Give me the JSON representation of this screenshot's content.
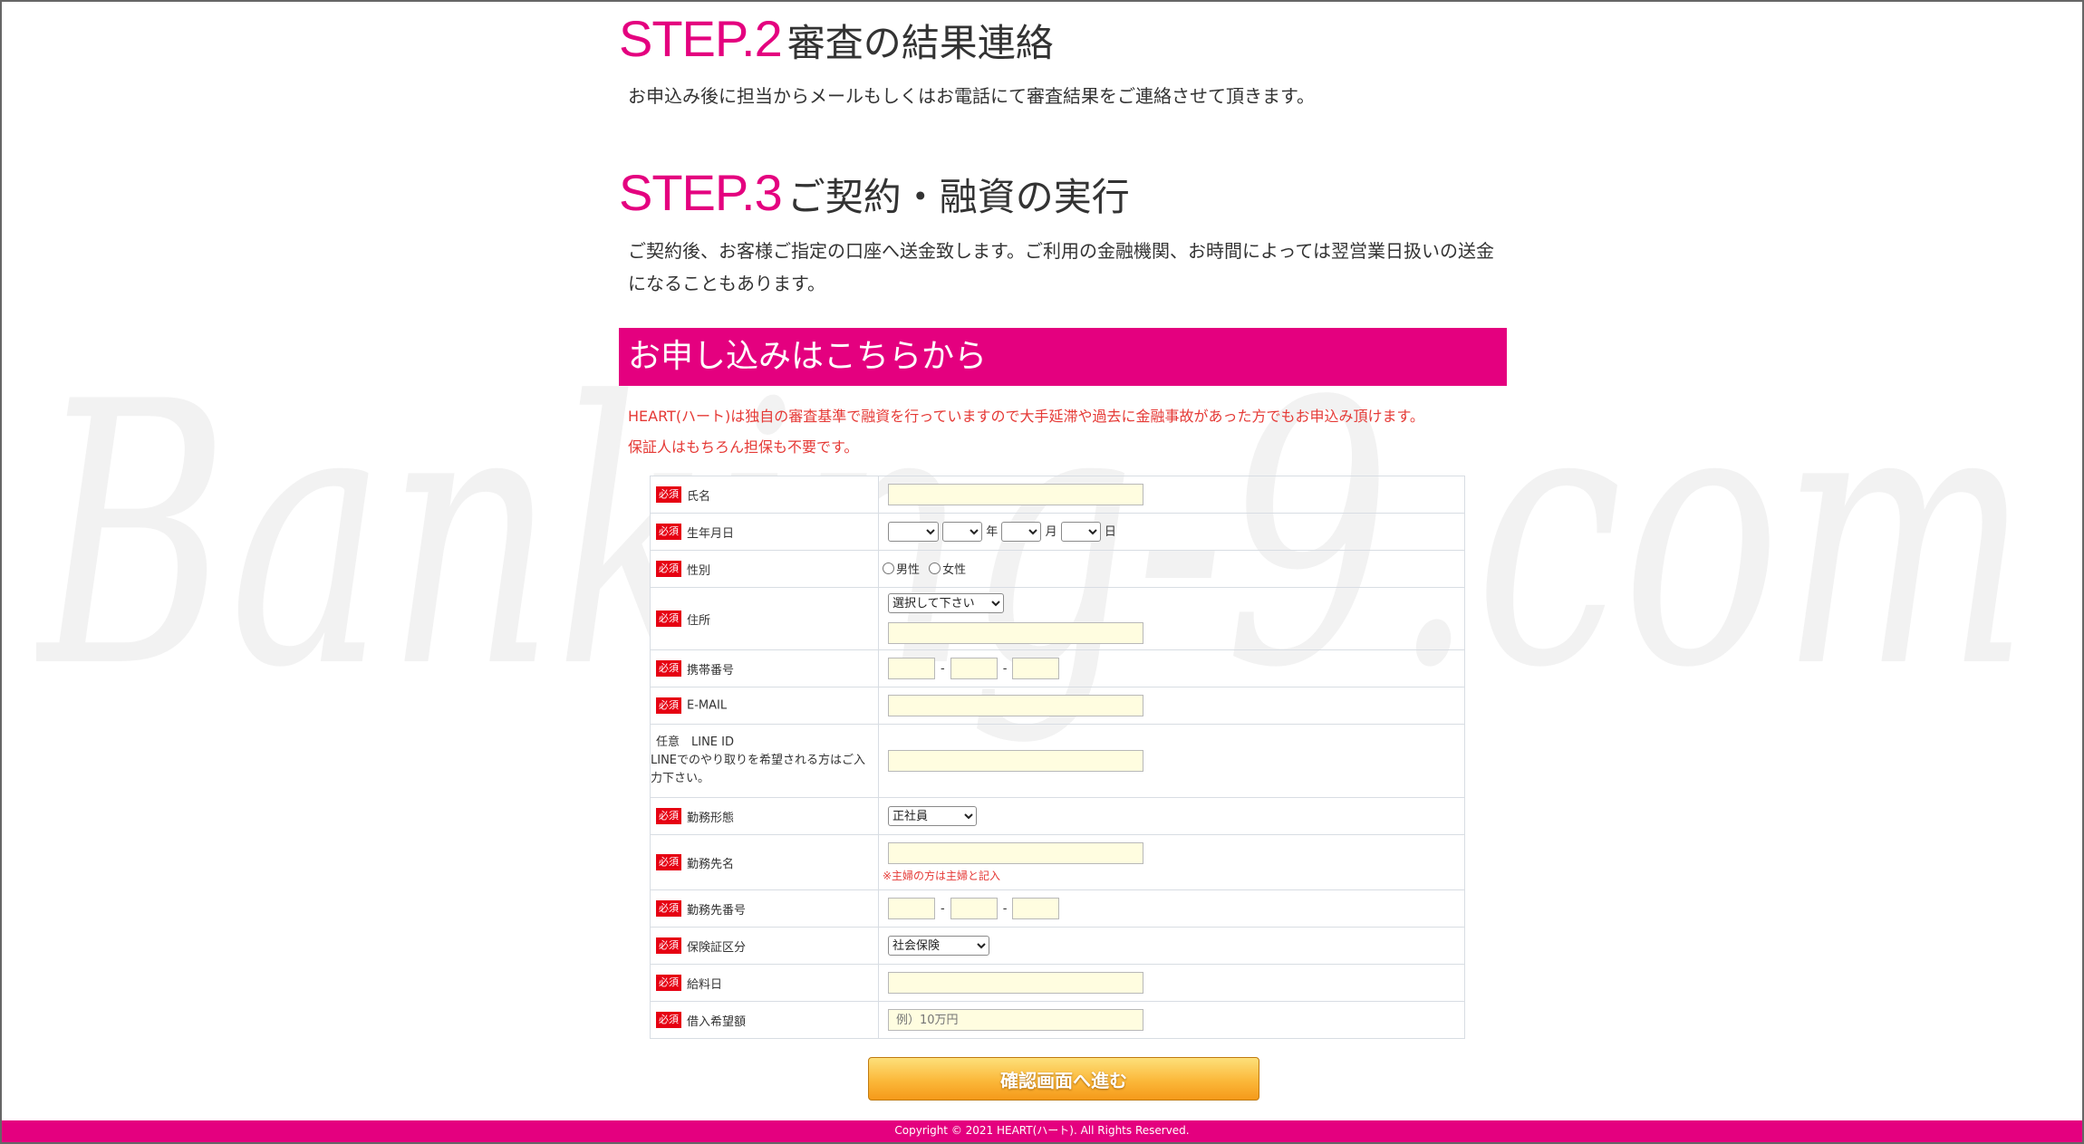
{
  "watermark": {
    "text": "Banking-9.com"
  },
  "steps": [
    {
      "label": "STEP.2",
      "title": "審査の結果連絡",
      "lines": [
        "お申込み後に担当からメールもしくはお電話にて審査結果をご連絡させて頂きます。"
      ]
    },
    {
      "label": "STEP.3",
      "title": "ご契約・融資の実行",
      "lines": [
        "ご契約後、お客様ご指定の口座へ送金致します。ご利用の金融機関、お時間によっては翌営業日扱いの送金",
        "になることもあります。"
      ]
    }
  ],
  "application": {
    "heading": "お申し込みはこちらから",
    "notice_1": "HEART(ハート)は独自の審査基準で融資を行っていますので大手延滞や過去に金融事故があった方でもお申込み頂けます。",
    "notice_2": "保証人はもちろん担保も不要です。",
    "required_badge": "必須",
    "fields": {
      "name": {
        "label": "氏名"
      },
      "birthdate": {
        "label": "生年月日",
        "year": "年",
        "month": "月",
        "day": "日"
      },
      "gender": {
        "label": "性別",
        "male": "男性",
        "female": "女性"
      },
      "address": {
        "label": "住所",
        "select": "選択して下さい"
      },
      "mobile": {
        "label": "携帯番号",
        "sep": "-"
      },
      "email": {
        "label": "E-MAIL"
      },
      "line": {
        "label_1": "任意　LINE ID",
        "label_2": "LINEでのやり取りを希望される方はご入",
        "label_3": "力下さい。"
      },
      "employment": {
        "label": "勤務形態",
        "select": "正社員"
      },
      "workplace": {
        "label": "勤務先名",
        "note": "※主婦の方は主婦と記入"
      },
      "work_phone": {
        "label": "勤務先番号",
        "sep": "-"
      },
      "insurance": {
        "label": "保険証区分",
        "select": "社会保険"
      },
      "payday": {
        "label": "給料日"
      },
      "loan_amount": {
        "label": "借入希望額",
        "placeholder": "例）10万円"
      }
    },
    "submit": "確認画面へ進む"
  },
  "footer": {
    "copyright": "Copyright © 2021 HEART(ハート). All Rights Reserved."
  },
  "colors": {
    "accent": "#e4007f",
    "required": "#e60012",
    "input_bg": "#fffde0",
    "button": "#fbb83a"
  }
}
